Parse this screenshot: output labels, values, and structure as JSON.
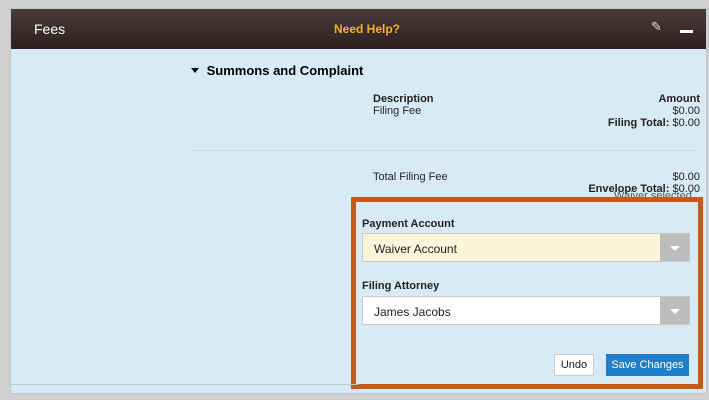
{
  "header": {
    "title": "Fees",
    "help": "Need Help?"
  },
  "section": {
    "title": "Summons and Complaint"
  },
  "fees": {
    "col_description": "Description",
    "col_amount": "Amount",
    "filing_fee_label": "Filing Fee",
    "filing_fee_amount": "$0.00",
    "filing_total_label": "Filing Total:",
    "filing_total_value": "$0.00",
    "total_filing_fee_label": "Total Filing Fee",
    "total_filing_fee_amount": "$0.00",
    "envelope_total_label": "Envelope Total:",
    "envelope_total_value": "$0.00",
    "waiver_note": "Waiver selected"
  },
  "payment": {
    "account_label": "Payment Account",
    "account_value": "Waiver Account",
    "attorney_label": "Filing Attorney",
    "attorney_value": "James Jacobs"
  },
  "actions": {
    "undo": "Undo",
    "save": "Save Changes"
  },
  "colors": {
    "header_bg": "#2e2020",
    "help_text": "#f0b323",
    "panel_bg": "#d8eaf5",
    "highlight_border": "#c45a1a",
    "save_button": "#1f7ec8",
    "waiver_field_bg": "#fdf5d9"
  }
}
